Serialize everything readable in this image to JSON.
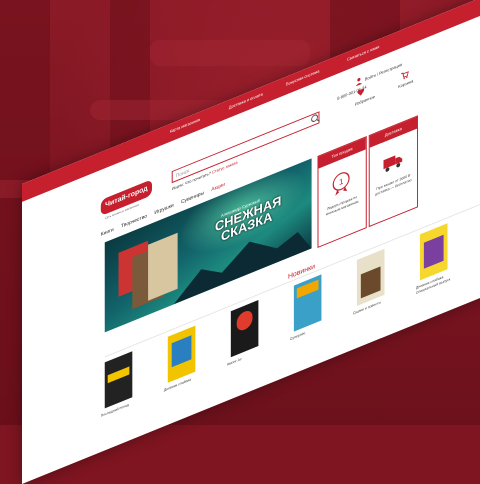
{
  "header": {
    "top_links": [
      "Карта магазинов",
      "Доставка и оплата",
      "Бонусная система",
      "Связаться с нами"
    ],
    "logo_text": "Читай-город",
    "logo_tagline": "Сеть книжных магазинов",
    "search_placeholder": "Поиск",
    "phone": "8-800-301-06-34",
    "hint_text": "Ищем: Что почитать?",
    "hint_link": "Статус заказа",
    "login_label": "Войти / Регистрация",
    "favorites_label": "Избранное",
    "cart_label": "Корзина"
  },
  "nav": {
    "items": [
      "Книги",
      "Творчество",
      "Игрушки",
      "Сувениры",
      "Акции"
    ]
  },
  "banner": {
    "author": "Александр Сурковый",
    "title_line1": "СНЕЖНАЯ",
    "title_line2": "СКАЗКА"
  },
  "promos": [
    {
      "title": "Топ продаж",
      "icon": "medal-icon",
      "text": "Лидеры продаж по книжным магазинам"
    },
    {
      "title": "Доставка",
      "icon": "delivery-truck-icon",
      "text": "При заказе от 2000 ₽ доставка — бесплатно"
    }
  ],
  "section": {
    "title": "Новинки"
  },
  "books": [
    {
      "cover_color": "#222222",
      "caption": "Последний поход"
    },
    {
      "cover_color": "#f2c400",
      "caption": "Дневник слабака"
    },
    {
      "cover_color": "#1a1a1a",
      "caption": "Амонг Ас"
    },
    {
      "cover_color": "#3aa0c8",
      "caption": "Суперпёс"
    },
    {
      "cover_color": "#e8e0c8",
      "caption": "Сказки и повести"
    },
    {
      "cover_color": "#f6d72e",
      "caption": "Дневник слабака. Специальный выпуск"
    }
  ],
  "colors": {
    "brand_red": "#c6202e",
    "background_red": "#7e1520"
  }
}
